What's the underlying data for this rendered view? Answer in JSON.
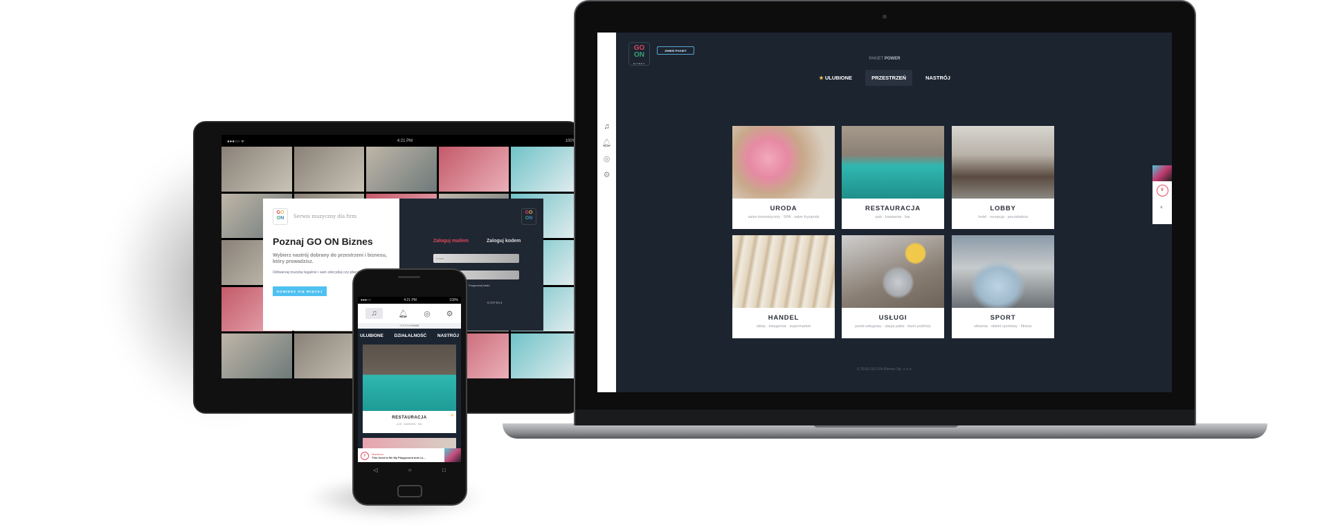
{
  "colors": {
    "screen_bg": "#1c2430",
    "accent_red": "#e3475a",
    "accent_blue": "#4fc1f0",
    "star": "#f3c64c"
  },
  "laptop": {
    "logo": {
      "line1": "GO",
      "line2": "ON",
      "sub": "BIZNES"
    },
    "change_package_label": "ZMIEŃ PAKIET",
    "package_prefix": "PAKIET",
    "package_name": "POWER",
    "sidebar_icons": [
      "music-icon",
      "bell-icon",
      "lifebuoy-icon",
      "gear-icon"
    ],
    "tabs": [
      {
        "label": "ULUBIONE",
        "icon": "star-icon",
        "active": false
      },
      {
        "label": "PRZESTRZEŃ",
        "active": true
      },
      {
        "label": "NASTRÓJ",
        "active": false
      }
    ],
    "tiles": [
      {
        "title": "URODA",
        "subtitle": "salon kosmetyczny · SPA · salon fryzjerski"
      },
      {
        "title": "RESTAURACJA",
        "subtitle": "pub · kawiarnia · bar"
      },
      {
        "title": "LOBBY",
        "subtitle": "hotel · recepcja · poczekalnia"
      },
      {
        "title": "HANDEL",
        "subtitle": "sklep · księgarnia · supermarket"
      },
      {
        "title": "USŁUGI",
        "subtitle": "punkt usługowy · stacja paliw · biuro podróży"
      },
      {
        "title": "SPORT",
        "subtitle": "siłownia · obiekt sportowy · fitness"
      }
    ],
    "footer": "© 2016 GO ON Biznes Sp. z o.o.",
    "player": {
      "state": "playing",
      "pause_icon": "pause-icon",
      "volume_icon": "volume-icon"
    }
  },
  "tablet": {
    "status": {
      "time": "4:21 PM",
      "battery": "100%"
    },
    "tagline": "Serwis muzyczny dla firm",
    "headline": "Poznaj GO ON Biznes",
    "subheadline": "Wybierz nastrój dobrany do przestrzeni i biznesu, który prowadzisz.",
    "body": "Odtwarzaj muzykę legalnie i sam zdecyduj czy płacić OZZ.",
    "more_button": "DOWIEDZ SIĘ WIĘCEJ",
    "login_email_tab": "Zaloguj mailem",
    "login_code_tab": "Zaloguj kodem",
    "email_placeholder": "e-mail",
    "password_placeholder": "",
    "remind_password": "Przypomnij hasło",
    "back_button": "COFNIJ"
  },
  "phone": {
    "status": {
      "time": "4:21 PM",
      "battery": "100%"
    },
    "offer_prefix": "OFERTA",
    "offer_name": "POWER",
    "nav": [
      "ULUBIONE",
      "DZIAŁALNOŚĆ",
      "NASTRÓJ"
    ],
    "card": {
      "title": "RESTAURACJA",
      "subtitle": "pub · kawiarnia · bar"
    },
    "player": {
      "artist": "Madonna",
      "track": "This Used to Be My Playground and Lo..."
    }
  }
}
